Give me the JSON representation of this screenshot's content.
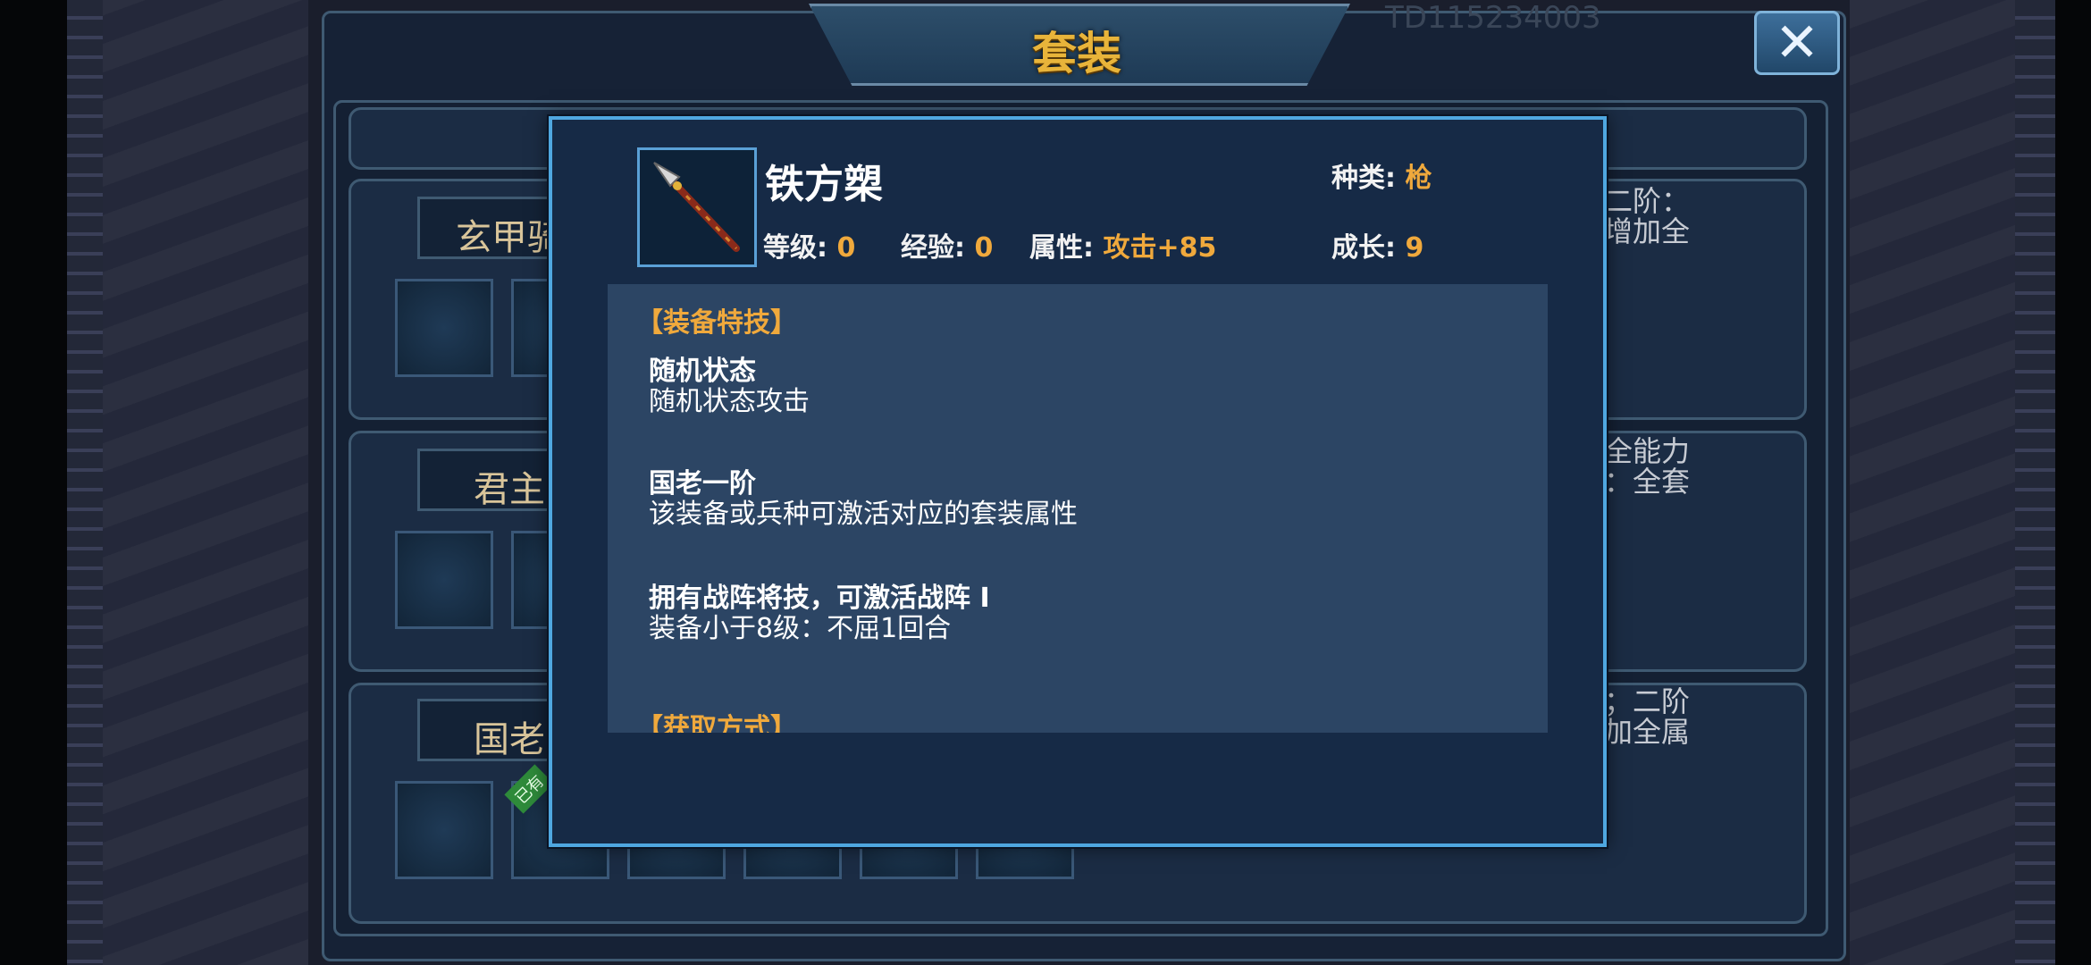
{
  "window": {
    "title": "套装",
    "top_code": "TD115234003",
    "close_label": "✕"
  },
  "suits": [
    {
      "name": "玄甲骑",
      "desc": "二阶：\n增加全"
    },
    {
      "name": "君主",
      "desc": "全能力\n：全套"
    },
    {
      "name": "国老",
      "desc": "；二阶\n加全属",
      "owned_badge": "已有"
    }
  ],
  "item": {
    "name": "铁方槊",
    "icon": "spear-icon",
    "level_label": "等级:",
    "level": "0",
    "exp_label": "经验:",
    "exp": "0",
    "attr_label": "属性:",
    "attr": "攻击+85",
    "type_label": "种类:",
    "type": "枪",
    "growth_label": "成长:",
    "growth": "9"
  },
  "skills": {
    "section_title": "【装备特技】",
    "entries": [
      {
        "title": "随机状态",
        "body": "随机状态攻击"
      },
      {
        "title": "国老一阶",
        "body": "该装备或兵种可激活对应的套装属性"
      },
      {
        "title": "拥有战阵将技，可激活战阵 I",
        "body": "装备小于8级：不屈1回合"
      }
    ],
    "next_section_title": "【获取方式】"
  },
  "colors": {
    "accent": "#f0a93c",
    "popup_border": "#4fa7e0",
    "title_gold": "#e8b43a"
  }
}
